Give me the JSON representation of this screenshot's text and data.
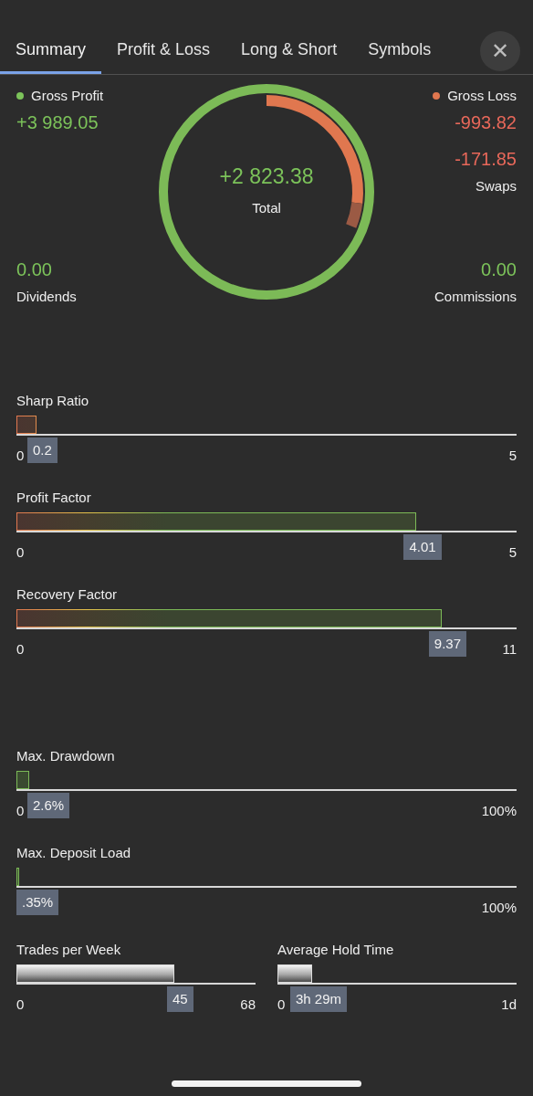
{
  "tabs": [
    {
      "label": "Summary",
      "selected": true
    },
    {
      "label": "Profit & Loss",
      "selected": false
    },
    {
      "label": "Long & Short",
      "selected": false
    },
    {
      "label": "Symbols",
      "selected": false
    }
  ],
  "close_button": {
    "label": "✕"
  },
  "summary": {
    "left": [
      {
        "label": "Gross Profit",
        "value": "+3 989.05",
        "kind": "positive",
        "color": "#7cc35a"
      },
      {
        "label": "Dividends",
        "value": "0.00",
        "kind": "positive"
      }
    ],
    "total": {
      "value": "+2 823.38",
      "label": "Total",
      "kind": "positive"
    },
    "right": [
      {
        "label": "Gross Loss",
        "value": "-993.82",
        "kind": "negative",
        "color": "#e0774f"
      },
      {
        "label": "Swaps",
        "value": "-171.85",
        "kind": "negative"
      },
      {
        "label": "Commissions",
        "value": "0.00",
        "kind": "positive"
      }
    ]
  },
  "sections": [
    {
      "rows": [
        {
          "meters": [
            {
              "kind": "ratio",
              "label": "Sharp Ratio",
              "level": 0.04,
              "reading": "0.2",
              "min": "0",
              "max": "5"
            }
          ]
        },
        {
          "meters": [
            {
              "kind": "ratio",
              "label": "Profit Factor",
              "level": 0.8,
              "reading": "4.01",
              "min": "0",
              "max": "5"
            }
          ]
        },
        {
          "meters": [
            {
              "kind": "ratio",
              "label": "Recovery Factor",
              "level": 0.85,
              "reading": "9.37",
              "min": "0",
              "max": "11"
            }
          ]
        }
      ]
    },
    {
      "rows": [
        {
          "meters": [
            {
              "kind": "percent",
              "label": "Max. Drawdown",
              "level": 0.026,
              "reading": "2.6%",
              "min": "0",
              "max": "100%"
            }
          ]
        },
        {
          "meters": [
            {
              "kind": "percent",
              "label": "Max. Deposit Load",
              "level": 0.0035,
              "reading": ".35%",
              "max": "100%"
            }
          ]
        },
        {
          "meters": [
            {
              "kind": "count",
              "label": "Trades per Week",
              "level": 0.66,
              "reading": "45",
              "min": "0",
              "max": "68"
            },
            {
              "kind": "count",
              "label": "Average Hold Time",
              "level": 0.145,
              "reading": "3h 29m",
              "min": "0",
              "max": "1d"
            }
          ]
        }
      ]
    }
  ]
}
